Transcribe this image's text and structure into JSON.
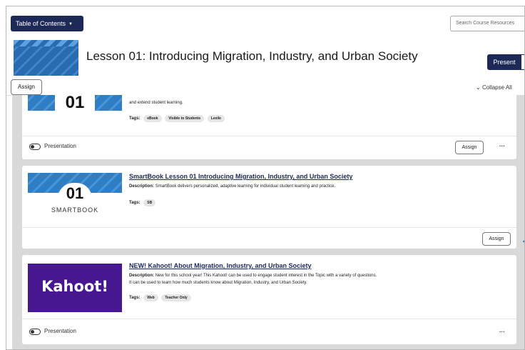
{
  "toolbar": {
    "toc_label": "Table of Contents",
    "search_placeholder": "Search Course Resources"
  },
  "lesson": {
    "title": "Lesson 01: Introducing Migration, Industry, and Urban Society",
    "present_label": "Present",
    "assign_label": "Assign",
    "collapse_label": "Collapse All"
  },
  "cards": [
    {
      "thumb_number": "01",
      "desc_tail": "and extend student learning.",
      "tags_label": "Tags:",
      "tags": [
        "eBook",
        "Visible to Students",
        "Lexile"
      ],
      "presentation_label": "Presentation",
      "assign_label": "Assign",
      "more_label": "···"
    },
    {
      "thumb_number": "01",
      "thumb_caption": "SMARTBOOK",
      "title": "SmartBook Lesson 01 Introducing Migration, Industry, and Urban Society",
      "desc_label": "Description:",
      "desc": "SmartBook delivers personalized, adaptive learning for individual student learning and practice.",
      "tags_label": "Tags:",
      "tags": [
        "SB"
      ],
      "assign_label": "Assign"
    },
    {
      "thumb_brand": "Kahoot!",
      "title": "NEW! Kahoot! About Migration, Industry, and Urban Society",
      "desc_label": "Description:",
      "desc": "New for this school year! This Kahoot! can be used to engage student interest in the Topic with a variety of questions.",
      "desc2": "It can be used to learn how much students know about Migration, Industry, and Urban Society.",
      "tags_label": "Tags:",
      "tags": [
        "Web",
        "Teacher Only"
      ],
      "presentation_label": "Presentation",
      "more_label": "···"
    }
  ],
  "colors": {
    "navy": "#1d2a57",
    "kahoot_purple": "#46178f",
    "blue": "#2f7dc4"
  }
}
